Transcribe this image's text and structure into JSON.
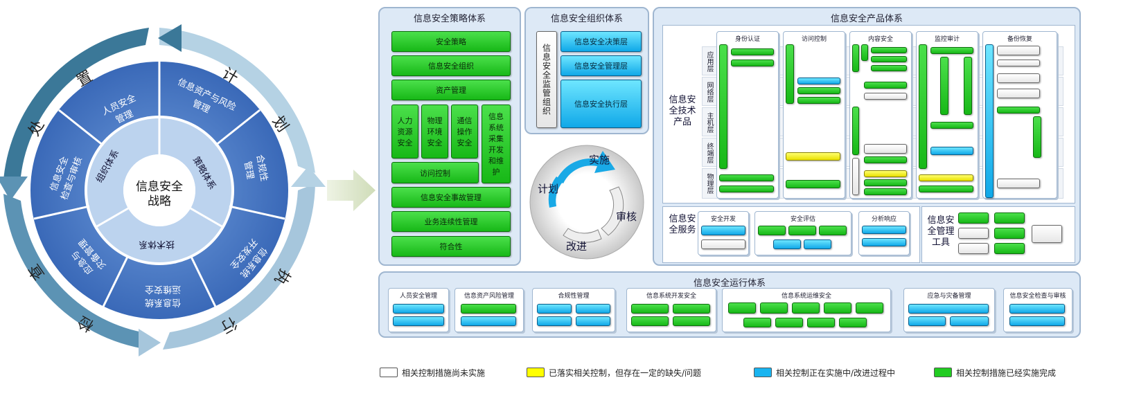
{
  "wheel": {
    "center": [
      "信息安全",
      "战略"
    ],
    "ring2": {
      "org": "组织体系",
      "strategy": "策略体系",
      "tech": "技术体系"
    },
    "sectors": {
      "s1": [
        "人员安全",
        "管理"
      ],
      "s2": [
        "信息资产与风险",
        "管理"
      ],
      "s3": [
        "合规性",
        "管理"
      ],
      "s4": [
        "信息系统",
        "开发安全"
      ],
      "s5": [
        "信息系统",
        "运维安全"
      ],
      "s6": [
        "应急与",
        "灾备管理"
      ],
      "s7": [
        "信息安全",
        "检查与审核"
      ]
    },
    "outer": {
      "plan": [
        "计",
        "划"
      ],
      "do": [
        "执",
        "行"
      ],
      "check": [
        "检",
        "查"
      ],
      "act": [
        "处",
        "置"
      ]
    }
  },
  "policy": {
    "title": "信息安全策略体系",
    "items": [
      "安全策略",
      "信息安全组织",
      "资产管理"
    ],
    "small": [
      "人力资源安全",
      "物理环境安全",
      "通信操作安全"
    ],
    "dev": "信息系统采集开发和维护",
    "access": "访问控制",
    "items2": [
      "信息安全事故管理",
      "业务连续性管理",
      "符合性"
    ]
  },
  "org": {
    "title": "信息安全组织体系",
    "supervise": "信息安全监管组织",
    "layers": [
      "信息安全决策层",
      "信息安全管理层",
      "信息安全执行层"
    ]
  },
  "pdca": {
    "do": "实施",
    "plan": "计划",
    "check": "审核",
    "act": "改进"
  },
  "product": {
    "title": "信息安全产品体系",
    "tech_label": "信息安全技术产品",
    "rows": [
      "应用层",
      "网络层",
      "主机层",
      "终端层",
      "物理层"
    ],
    "columns": [
      "身份认证",
      "访问控制",
      "内容安全",
      "监控审计",
      "备份恢复"
    ],
    "service_label": "信息安全服务",
    "services": [
      "安全开发",
      "安全评估",
      "分析响应"
    ],
    "tool_label": "信息安全管理工具"
  },
  "ops": {
    "title": "信息安全运行体系",
    "groups": [
      "人员安全管理",
      "信息资产风险管理",
      "合规性管理",
      "信息系统开发安全",
      "信息系统运维安全",
      "应急与灾备管理",
      "信息安全检查与审核"
    ]
  },
  "legend": [
    {
      "color": "#ffffff",
      "text": "相关控制措施尚未实施"
    },
    {
      "color": "#ffff00",
      "text": "已落实相关控制，但存在一定的缺失/问题"
    },
    {
      "color": "#19b4f0",
      "text": "相关控制正在实施中/改进过程中"
    },
    {
      "color": "#22cc22",
      "text": "相关控制措施已经实施完成"
    }
  ]
}
